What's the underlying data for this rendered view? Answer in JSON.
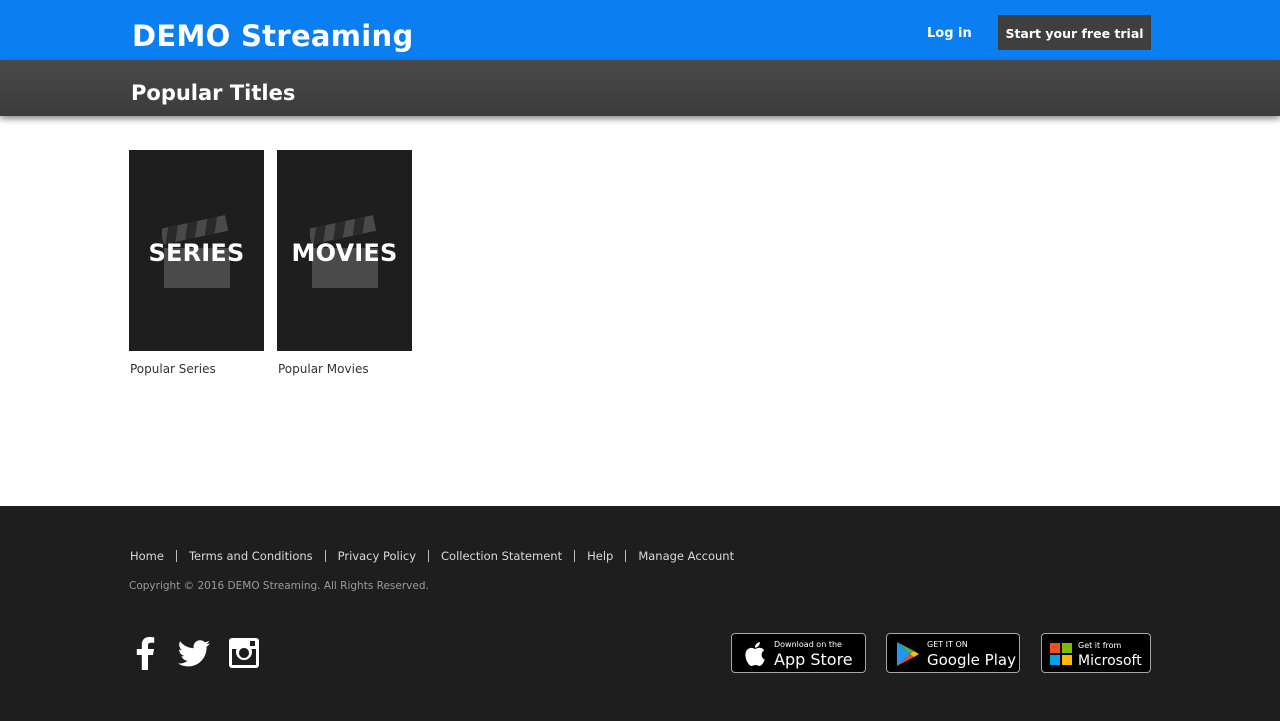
{
  "header": {
    "brand": "DEMO Streaming",
    "login_label": "Log in",
    "trial_label": "Start your free trial",
    "background_color": "#0b7ff2"
  },
  "subheader": {
    "title": "Popular Titles",
    "background_color": "#444444"
  },
  "tiles": [
    {
      "overlay_text": "SERIES",
      "caption": "Popular Series",
      "icon": "clapperboard-icon"
    },
    {
      "overlay_text": "MOVIES",
      "caption": "Popular Movies",
      "icon": "clapperboard-icon"
    }
  ],
  "footer": {
    "links": [
      "Home",
      "Terms and Conditions",
      "Privacy Policy",
      "Collection Statement",
      "Help",
      "Manage Account"
    ],
    "copyright": "Copyright © 2016 DEMO Streaming. All Rights Reserved.",
    "social": [
      "facebook-icon",
      "twitter-icon",
      "instagram-icon"
    ],
    "stores": {
      "app_store": {
        "small": "Download on the",
        "big": "App Store"
      },
      "google_play": {
        "small": "GET IT ON",
        "big": "Google Play"
      },
      "microsoft": {
        "small": "Get it from",
        "big": "Microsoft"
      }
    },
    "background_color": "#1e1e1e"
  }
}
